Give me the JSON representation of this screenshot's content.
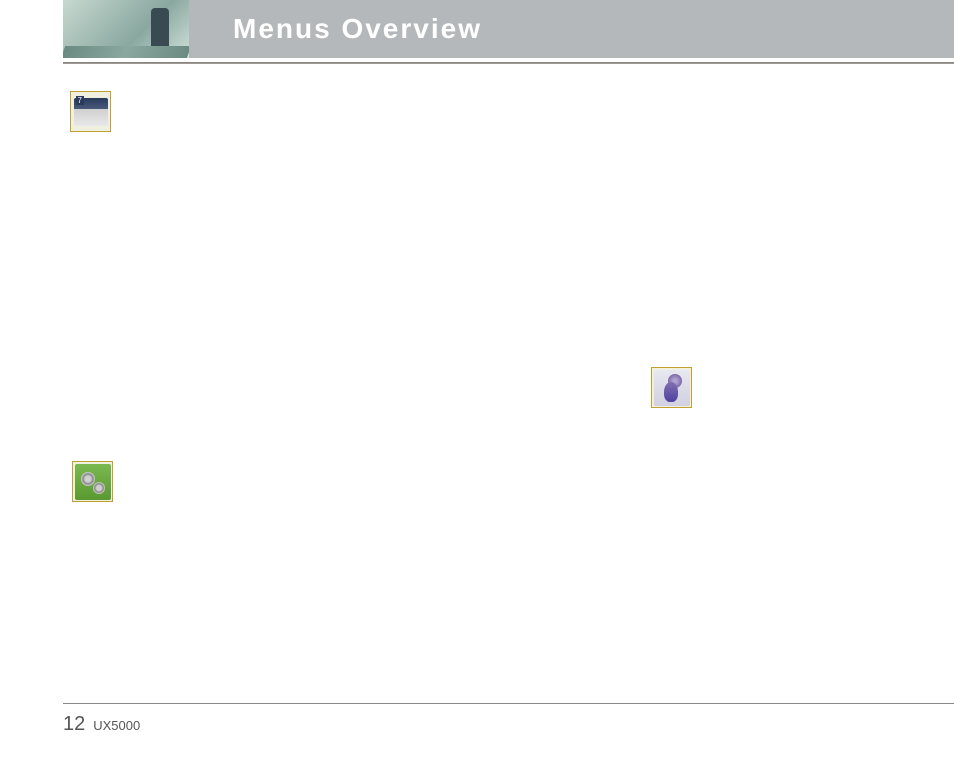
{
  "header": {
    "title": "Menus Overview"
  },
  "icons": {
    "briefcase": "briefcase-icon",
    "gears": "gears-icon",
    "mouse": "mouse-icon"
  },
  "footer": {
    "page_number": "12",
    "model": "UX5000"
  }
}
